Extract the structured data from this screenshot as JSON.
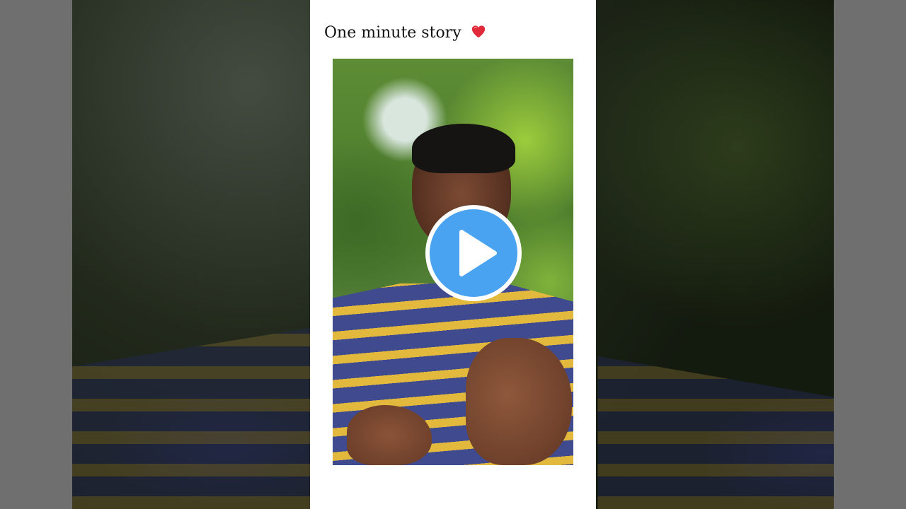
{
  "post": {
    "title": "One minute story",
    "title_emoji_icon": "red-heart-icon"
  },
  "player": {
    "play_icon": "play-icon",
    "accent_color": "#4aa3f0"
  }
}
